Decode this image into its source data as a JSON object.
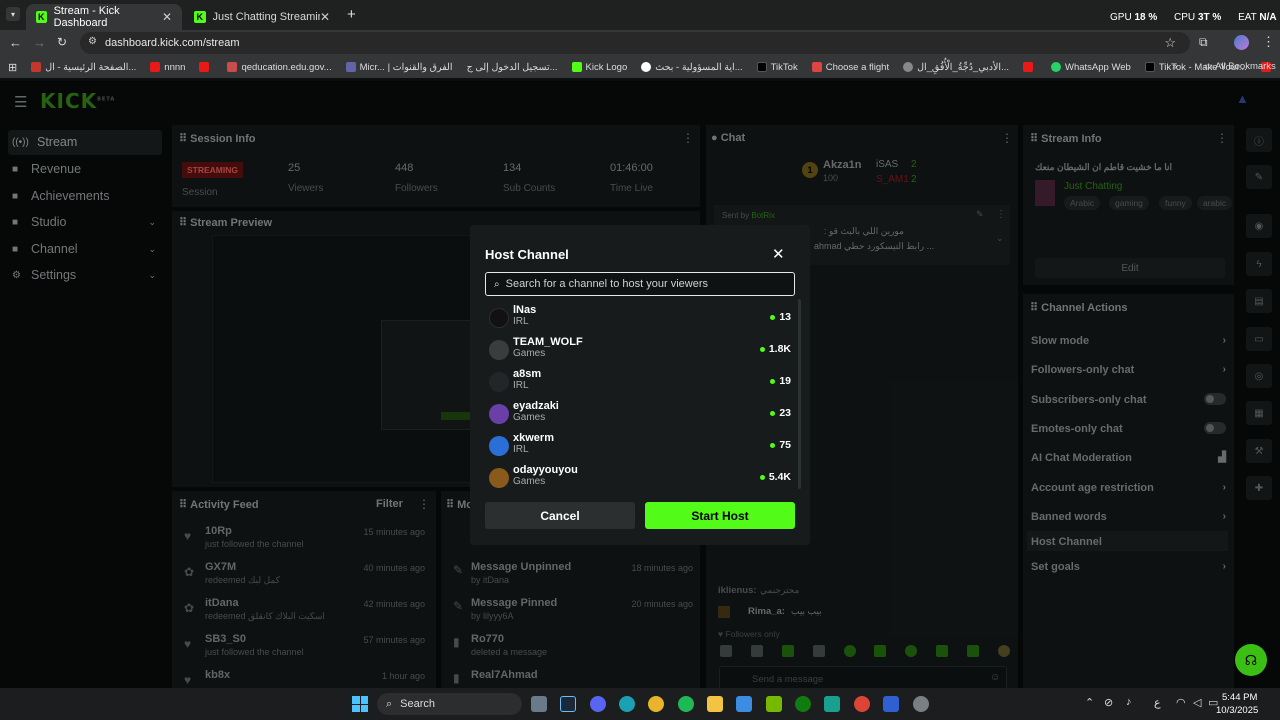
{
  "browser": {
    "tabs": [
      {
        "title": "Stream - Kick Dashboard",
        "active": true
      },
      {
        "title": "Just Chatting Streaming - Live",
        "active": false
      }
    ],
    "url": "dashboard.kick.com/stream",
    "status": {
      "gpu_label": "GPU",
      "gpu_value": "18 %",
      "cpu_label": "CPU",
      "cpu_value": "3T %",
      "eat_label": "EAT",
      "eat_value": "N/A"
    },
    "bookmarks": [
      "الصفحة الرئيسية - ال...",
      "nnnn",
      "qeducation.edu.gov...",
      "Micr... | الفرق والقنوات",
      "تسجيل الدخول إلى ج...",
      "Kick Logo",
      "اية المسؤولية - بحث...",
      "TikTok",
      "Choose a flight",
      "الأدبي_دُجِّةُ_الْأُفُقِ_ال...",
      "WhatsApp Web",
      "TikTok - Make Your..."
    ],
    "all_bookmarks": "All Bookmarks"
  },
  "sidebar": {
    "logo": "KICK",
    "logo_badge": "BETA",
    "items": [
      {
        "label": "Stream",
        "icon": "broadcast-icon",
        "chevron": false
      },
      {
        "label": "Revenue",
        "icon": "dollar-icon",
        "chevron": false
      },
      {
        "label": "Achievements",
        "icon": "trophy-icon",
        "chevron": false
      },
      {
        "label": "Studio",
        "icon": "studio-icon",
        "chevron": true
      },
      {
        "label": "Channel",
        "icon": "channel-icon",
        "chevron": true
      },
      {
        "label": "Settings",
        "icon": "gear-icon",
        "chevron": true
      }
    ]
  },
  "session": {
    "title": "Session Info",
    "badge": "STREAMING",
    "stats": [
      {
        "value": "",
        "label": "Session"
      },
      {
        "value": "25",
        "label": "Viewers"
      },
      {
        "value": "448",
        "label": "Followers"
      },
      {
        "value": "134",
        "label": "Sub Counts"
      },
      {
        "value": "01:46:00",
        "label": "Time Live"
      }
    ]
  },
  "preview": {
    "title": "Stream Preview"
  },
  "activity": {
    "title": "Activity Feed",
    "filter": "Filter",
    "items": [
      {
        "name": "10Rp",
        "sub": "just followed the channel",
        "time": "15 minutes ago"
      },
      {
        "name": "GX7M",
        "sub": "redeemed كمل لبك",
        "time": "40 minutes ago"
      },
      {
        "name": "itDana",
        "sub": "redeemed اسكيت البلاك كانقلق",
        "time": "42 minutes ago"
      },
      {
        "name": "SB3_S0",
        "sub": "just followed the channel",
        "time": "57 minutes ago"
      },
      {
        "name": "kb8x",
        "sub": "",
        "time": "1 hour ago"
      }
    ]
  },
  "mod_log": {
    "title": "Mo",
    "items": [
      {
        "name": "Message Unpinned",
        "sub": "by itDana",
        "time": "18 minutes ago"
      },
      {
        "name": "Message Pinned",
        "sub": "by lilyyy6A",
        "time": "20 minutes ago"
      },
      {
        "name": "Ro770",
        "sub": "deleted a message",
        "time": ""
      },
      {
        "name": "Real7Ahmad",
        "sub": "",
        "time": ""
      }
    ]
  },
  "chat": {
    "title": "Chat",
    "leaderboard": [
      {
        "name": "Akza1n",
        "points": "100"
      },
      {
        "name": "iSAS",
        "points": "2"
      },
      {
        "name": "S_AM1",
        "points": "2"
      }
    ],
    "pinned_by": "Sent by",
    "pinned_user": "BotRix",
    "pinned_text": ": مورين اللي بالبث قو",
    "pinned_text2": "ahmad رابط التيسكورد حطي ...",
    "messages": [
      {
        "user": "iklienus:",
        "text": "محترجنمي"
      },
      {
        "user": "Rima_a:",
        "text": "بيب بيب"
      }
    ],
    "followers_only": "Followers only",
    "placeholder": "Send a message",
    "send_label": "Chat"
  },
  "stream_info": {
    "title": "Stream Info",
    "stream_title": "انا ما خشيت قاطم ان الشيطان منعك",
    "category": "Just Chatting",
    "tags": [
      "Arabic",
      "gaming",
      "funny",
      "arabic"
    ],
    "edit": "Edit"
  },
  "channel_actions": {
    "title": "Channel Actions",
    "items": [
      {
        "label": "Slow mode",
        "control": "chevron"
      },
      {
        "label": "Followers-only chat",
        "control": "chevron"
      },
      {
        "label": "Subscribers-only chat",
        "control": "toggle"
      },
      {
        "label": "Emotes-only chat",
        "control": "toggle"
      },
      {
        "label": "AI Chat Moderation",
        "control": "chart"
      },
      {
        "label": "Account age restriction",
        "control": "chevron"
      },
      {
        "label": "Banned words",
        "control": "chevron"
      },
      {
        "label": "Host Channel",
        "control": "none"
      },
      {
        "label": "Set goals",
        "control": "chevron"
      }
    ]
  },
  "modal": {
    "title": "Host Channel",
    "search_placeholder": "Search for a channel to host your viewers",
    "channels": [
      {
        "name": "lNas",
        "category": "IRL",
        "viewers": "13",
        "avatar_color": "#111111"
      },
      {
        "name": "TEAM_WOLF",
        "category": "Games",
        "viewers": "1.8K",
        "avatar_color": "#3a3d3e"
      },
      {
        "name": "a8sm",
        "category": "IRL",
        "viewers": "19",
        "avatar_color": "#222628"
      },
      {
        "name": "eyadzaki",
        "category": "Games",
        "viewers": "23",
        "avatar_color": "#6a3fa8"
      },
      {
        "name": "xkwerm",
        "category": "IRL",
        "viewers": "75",
        "avatar_color": "#2b6fd6"
      },
      {
        "name": "odayyouyou",
        "category": "Games",
        "viewers": "5.4K",
        "avatar_color": "#8a5a1c"
      }
    ],
    "cancel": "Cancel",
    "start": "Start Host"
  },
  "taskbar": {
    "search": "Search",
    "time": "5:44 PM",
    "date": "10/3/2025",
    "lang": "ع"
  },
  "colors": {
    "accent": "#53fc18",
    "badge": "#e91916"
  }
}
